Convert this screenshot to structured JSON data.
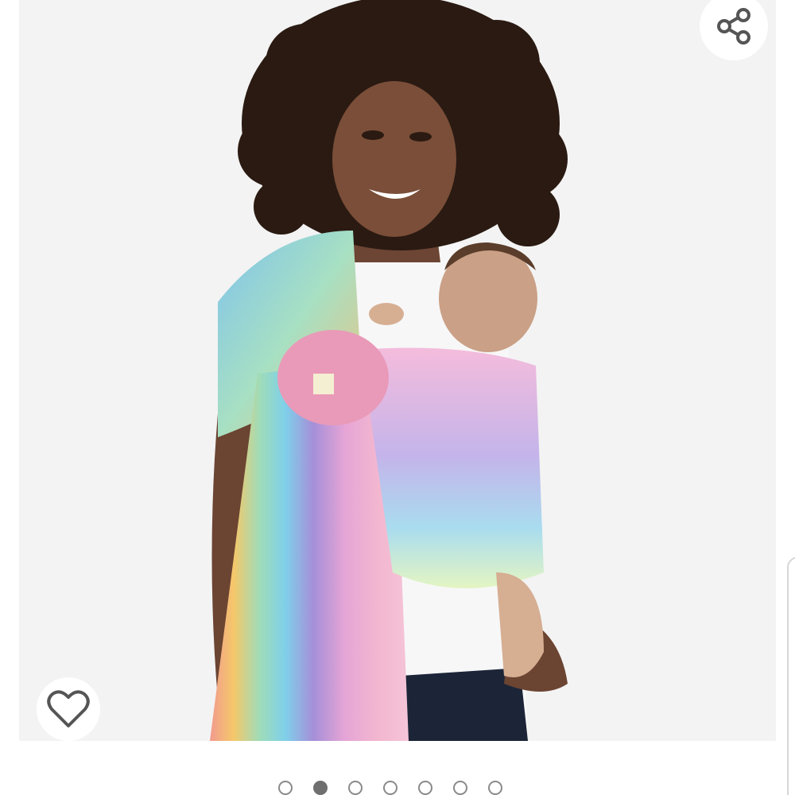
{
  "product_gallery": {
    "total_images": 7,
    "active_index": 1
  },
  "icons": {
    "share": "share-icon",
    "wishlist": "heart-outline-icon"
  },
  "colors": {
    "icon_gray": "#555555",
    "dot_active": "#6f6f6f",
    "dot_border": "#8a8a8a"
  }
}
